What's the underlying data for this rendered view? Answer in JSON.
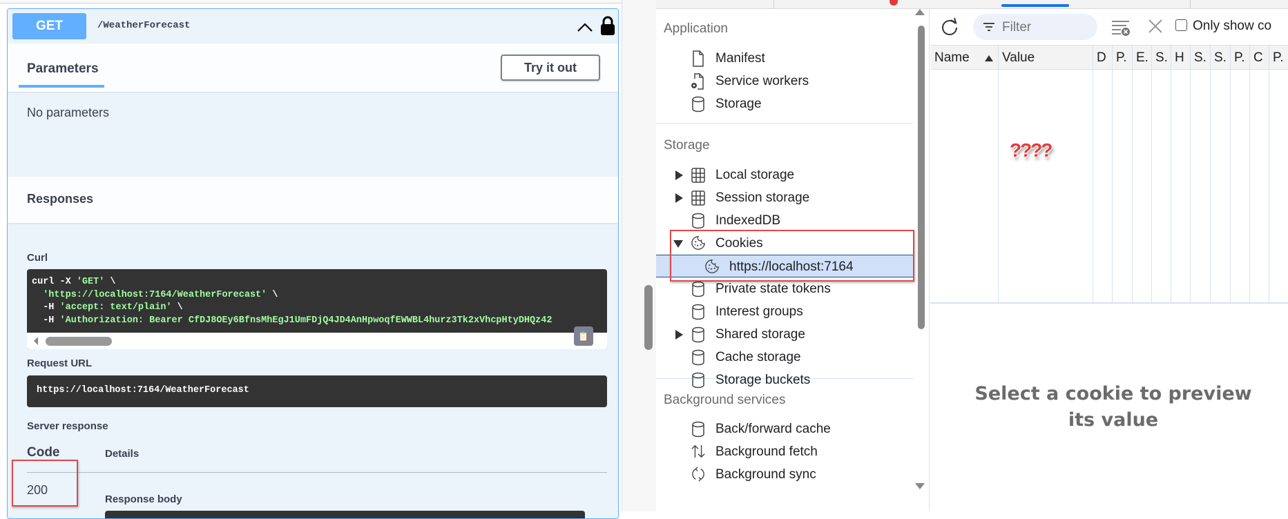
{
  "swagger": {
    "method": "GET",
    "path": "/WeatherForecast",
    "parameters_title": "Parameters",
    "try_it_out_label": "Try it out",
    "no_parameters": "No parameters",
    "responses_title": "Responses",
    "curl_label": "Curl",
    "curl_lines": [
      {
        "plain": "curl -X ",
        "str": "'GET'",
        "tail": " \\"
      },
      {
        "plain": "  ",
        "str": "'https://localhost:7164/WeatherForecast'",
        "tail": " \\"
      },
      {
        "plain": "  -H ",
        "str": "'accept: text/plain'",
        "tail": " \\"
      },
      {
        "plain": "  -H ",
        "str": "'Authorization: Bearer CfDJ8OEy6BfnsMhEgJ1UmFDjQ4JD4AnHpwoqfEWWBL4hurz3Tk2xVhcpHtyDHQz42",
        "tail": ""
      }
    ],
    "request_url_label": "Request URL",
    "request_url": "https://localhost:7164/WeatherForecast",
    "server_response_label": "Server response",
    "code_header": "Code",
    "details_header": "Details",
    "response_code": "200",
    "response_body_label": "Response body",
    "colors": {
      "get": "#61affe",
      "highlight": "#e04848"
    }
  },
  "devtools": {
    "sidebar": {
      "sections": [
        {
          "title": "Application",
          "items": [
            {
              "label": "Manifest",
              "icon": "file-icon"
            },
            {
              "label": "Service workers",
              "icon": "service-worker-icon"
            },
            {
              "label": "Storage",
              "icon": "database-icon"
            }
          ]
        },
        {
          "title": "Storage",
          "items": [
            {
              "label": "Local storage",
              "icon": "table-icon",
              "expand": "collapsed"
            },
            {
              "label": "Session storage",
              "icon": "table-icon",
              "expand": "collapsed"
            },
            {
              "label": "IndexedDB",
              "icon": "database-icon"
            },
            {
              "label": "Cookies",
              "icon": "cookie-icon",
              "expand": "expanded"
            },
            {
              "label": "https://localhost:7164",
              "icon": "cookie-icon",
              "selected": true,
              "child": true
            },
            {
              "label": "Private state tokens",
              "icon": "database-icon"
            },
            {
              "label": "Interest groups",
              "icon": "database-icon"
            },
            {
              "label": "Shared storage",
              "icon": "database-icon",
              "expand": "collapsed"
            },
            {
              "label": "Cache storage",
              "icon": "database-icon"
            },
            {
              "label": "Storage buckets",
              "icon": "database-icon"
            }
          ]
        },
        {
          "title": "Background services",
          "items": [
            {
              "label": "Back/forward cache",
              "icon": "database-icon"
            },
            {
              "label": "Background fetch",
              "icon": "up-down-arrows-icon"
            },
            {
              "label": "Background sync",
              "icon": "sync-icon"
            }
          ]
        }
      ]
    },
    "toolbar": {
      "filter_placeholder": "Filter",
      "only_show_label": "Only show co"
    },
    "table": {
      "columns": [
        "Name",
        "Value",
        "D",
        "P.",
        "E.",
        "S.",
        "H",
        "S.",
        "S.",
        "P.",
        "C",
        "P."
      ],
      "annotation": "????"
    },
    "preview_message": "Select a cookie to preview its value",
    "colors": {
      "accent": "#1a73e8",
      "selected_bg": "#cfe0f8"
    }
  }
}
